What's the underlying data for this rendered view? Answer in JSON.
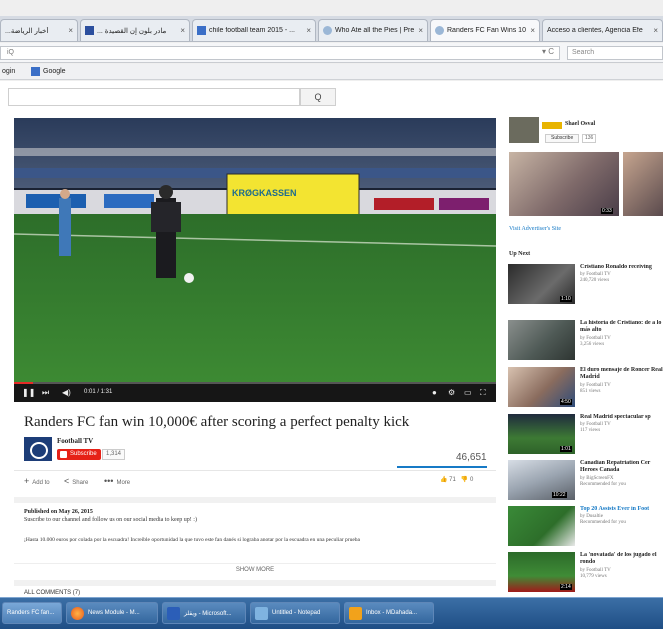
{
  "browser": {
    "tabs": [
      {
        "label": "...أخبار الرياضة",
        "icon": "page-icon"
      },
      {
        "label": "... مادر بلون إن القصيدة",
        "icon": "page-icon"
      },
      {
        "label": "chile football team 2015 - ...",
        "icon": "page-icon"
      },
      {
        "label": "Who Ate all the Pies | Pre...",
        "icon": "page-icon"
      },
      {
        "label": "Randers FC Fan Wins 100...",
        "icon": "page-icon"
      },
      {
        "label": "Acceso a clientes, Agencia Efe",
        "icon": "page-icon"
      }
    ],
    "close_glyph": "×",
    "url": "iQ",
    "reload_glyph": "▾ C",
    "search_placeholder": "Search",
    "bookmarks": [
      "ogin",
      "Google"
    ]
  },
  "youtube": {
    "search_button_glyph": "Q"
  },
  "player": {
    "time": "0:01 / 1:31",
    "progress": 0.04,
    "billboard_text": "KRØGKASSEN"
  },
  "video": {
    "title": "Randers FC fan win 10,000€ after scoring a perfect penalty kick",
    "channel": "Football TV",
    "subscribe_label": "Subscribe",
    "subscriber_count": "1,314",
    "views": "46,651",
    "actions": {
      "add_to": "Add to",
      "share": "Share",
      "more": "More",
      "likes": "71",
      "dislikes": "0"
    },
    "published": "Published on May 26, 2015",
    "description_line1": "Suscribe to our channel and follow us on our social media to keep up! :)",
    "description_line2": "¡Hasta 10.000 euros por colada por la escuadra! Increíble oportunidad la que tuvo este fan danés si lograba anotar por la escuadra en una peculiar prueba",
    "show_more": "SHOW MORE",
    "all_comments": "ALL COMMENTS (7)"
  },
  "sidebar": {
    "ad": {
      "channel": "Shael Osval",
      "subscribe": "Subscribe",
      "subscribe_count": "136",
      "duration": "0:33",
      "visit": "Visit Advertiser's Site"
    },
    "up_next_label": "Up Next",
    "related": [
      {
        "title": "Cristiano Ronaldo receiving",
        "meta1": "by Football TV",
        "meta2": "240,720 views",
        "duration": "1:10"
      },
      {
        "title": "La historia de Cristiano: de a lo más alto",
        "meta1": "by Football TV",
        "meta2": "3,256 views",
        "duration": ""
      },
      {
        "title": "El duro mensaje de Roncer Real Madrid",
        "meta1": "by Football TV",
        "meta2": "851 views",
        "duration": "4:50"
      },
      {
        "title": "Real Madrid spectacular sp",
        "meta1": "by Football TV",
        "meta2": "117 views",
        "duration": "1:01"
      },
      {
        "title": "Canadian Repatriation Cer Heroes Canada",
        "meta1": "by BigScreenFX",
        "meta2": "Recommended for you",
        "duration": "10:22"
      },
      {
        "title": "Top 20 Assists Ever in Foot",
        "meta1": "by Dusaltie",
        "meta2": "Recommended for you",
        "duration": ""
      },
      {
        "title": "La 'novatada' de los jugado el rondo",
        "meta1": "by Football TV",
        "meta2": "10,779 views",
        "duration": "2:14"
      }
    ]
  },
  "taskbar": {
    "items": [
      {
        "label": "Randers FC fan..."
      },
      {
        "label": "News Module - M..."
      },
      {
        "label": "ويقلز - Microsoft..."
      },
      {
        "label": "Untitled - Notepad"
      },
      {
        "label": "Inbox - MDahada..."
      }
    ]
  },
  "colors": {
    "accent_red": "#e62117",
    "link_blue": "#167ac6",
    "taskbar": "#2a5a92"
  }
}
